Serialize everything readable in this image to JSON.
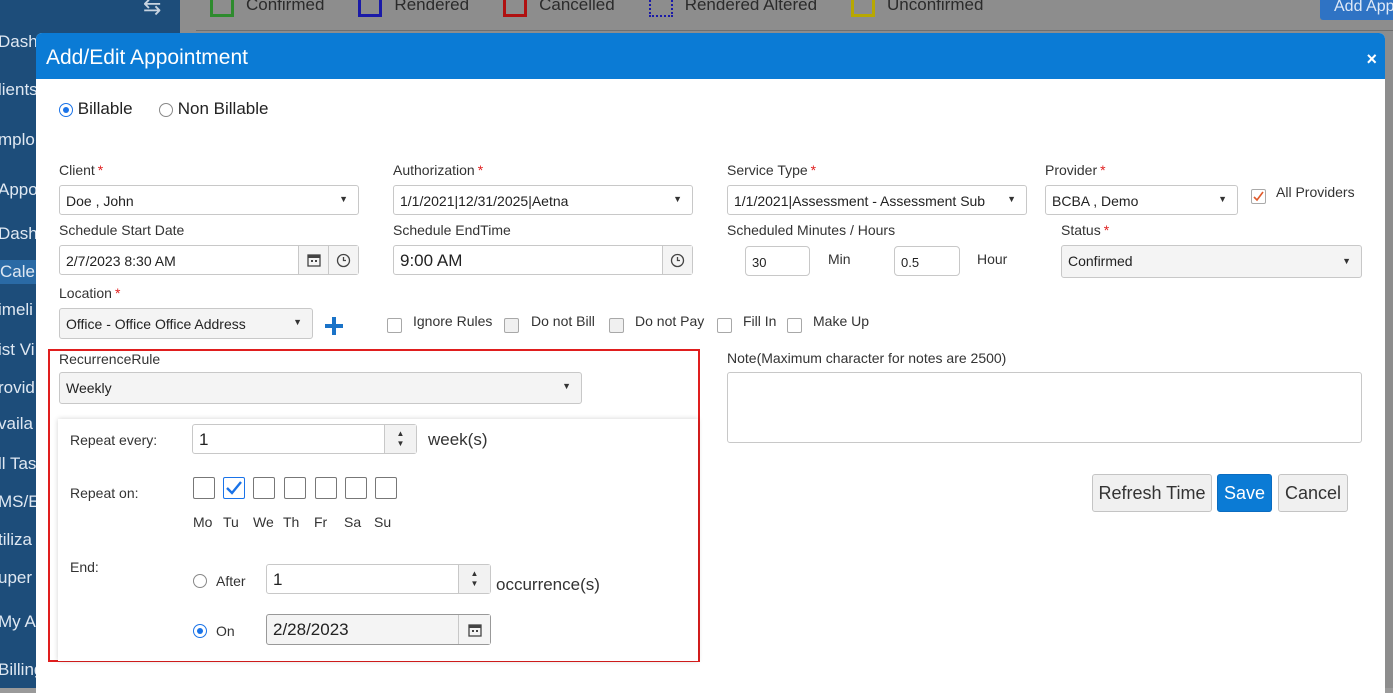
{
  "background": {
    "sidebar": [
      "Dashb",
      "lients",
      "mplo",
      "Appo",
      "Dashb",
      "Cale",
      "imeli",
      "ist Vi",
      "rovid",
      "vaila",
      "ll Tas",
      "MS/E",
      "tiliza",
      "uper",
      "My Ap",
      "Billing"
    ],
    "legend": [
      {
        "label": "Confirmed",
        "color": "#2e8b2e"
      },
      {
        "label": "Rendered",
        "color": "#1a1aa8"
      },
      {
        "label": "Cancelled",
        "color": "#b01010"
      },
      {
        "label": "Rendered Altered",
        "color": "#1a1aa8"
      },
      {
        "label": "Unconfirmed",
        "color": "#b8a800"
      }
    ],
    "add_button": "Add App"
  },
  "modal": {
    "title": "Add/Edit Appointment",
    "close": "×",
    "billing": {
      "billable": "Billable",
      "non_billable": "Non Billable",
      "selected": "Billable"
    },
    "client": {
      "label": "Client",
      "value": "Doe , John"
    },
    "authorization": {
      "label": "Authorization",
      "value": "1/1/2021|12/31/2025|Aetna"
    },
    "service_type": {
      "label": "Service Type",
      "value": "1/1/2021|Assessment - Assessment Sub"
    },
    "provider": {
      "label": "Provider",
      "value": "BCBA , Demo"
    },
    "all_providers": {
      "label": "All Providers",
      "checked": true
    },
    "schedule_start": {
      "label": "Schedule Start Date",
      "value": "2/7/2023 8:30 AM"
    },
    "schedule_end": {
      "label": "Schedule EndTime",
      "value": "9:00 AM"
    },
    "scheduled": {
      "label": "Scheduled Minutes / Hours",
      "minutes": "30",
      "min_unit": "Min",
      "hours": "0.5",
      "hour_unit": "Hour"
    },
    "status": {
      "label": "Status",
      "value": "Confirmed"
    },
    "location": {
      "label": "Location",
      "value": "Office - Office Office Address"
    },
    "options": [
      {
        "label": "Ignore Rules"
      },
      {
        "label": "Do not Bill"
      },
      {
        "label": "Do not Pay"
      },
      {
        "label": "Fill In"
      },
      {
        "label": "Make Up"
      }
    ],
    "recurrence": {
      "label": "RecurrenceRule",
      "value": "Weekly",
      "repeat_every_label": "Repeat every:",
      "repeat_every_value": "1",
      "repeat_every_unit": "week(s)",
      "repeat_on_label": "Repeat on:",
      "days": [
        {
          "label": "Mo",
          "checked": false
        },
        {
          "label": "Tu",
          "checked": true
        },
        {
          "label": "We",
          "checked": false
        },
        {
          "label": "Th",
          "checked": false
        },
        {
          "label": "Fr",
          "checked": false
        },
        {
          "label": "Sa",
          "checked": false
        },
        {
          "label": "Su",
          "checked": false
        }
      ],
      "end_label": "End:",
      "after_label": "After",
      "after_value": "1",
      "after_unit": "occurrence(s)",
      "on_label": "On",
      "on_value": "2/28/2023",
      "end_selected": "On"
    },
    "note": {
      "label": "Note(Maximum character for notes are 2500)",
      "value": ""
    },
    "buttons": {
      "refresh": "Refresh Time",
      "save": "Save",
      "cancel": "Cancel"
    },
    "required_marker": "*"
  }
}
